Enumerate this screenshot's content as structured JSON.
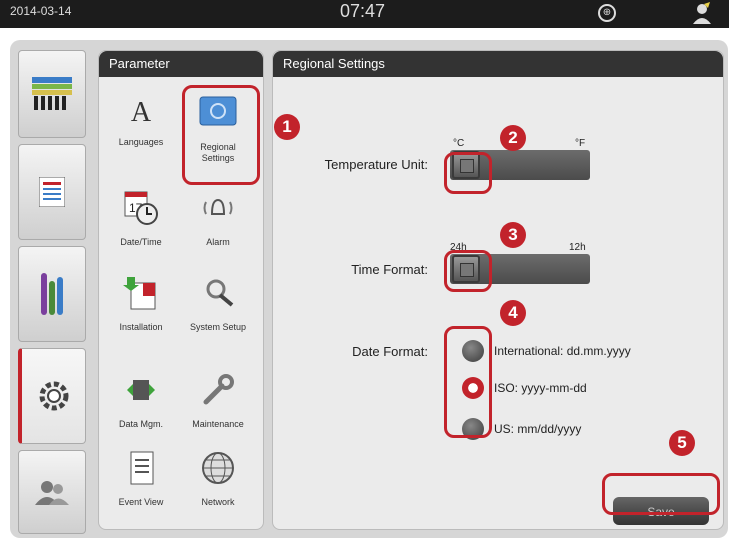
{
  "status_bar": {
    "date": "2014-03-14",
    "time": "07:47"
  },
  "parameter_panel": {
    "title": "Parameter",
    "items": [
      {
        "label": "Languages",
        "icon": "languages-icon"
      },
      {
        "label": "Regional Settings",
        "icon": "regional-settings-icon"
      },
      {
        "label": "Date/Time",
        "icon": "datetime-icon"
      },
      {
        "label": "Alarm",
        "icon": "alarm-icon"
      },
      {
        "label": "Installation",
        "icon": "installation-icon"
      },
      {
        "label": "System Setup",
        "icon": "system-setup-icon"
      },
      {
        "label": "Data Mgm.",
        "icon": "data-management-icon"
      },
      {
        "label": "Maintenance",
        "icon": "maintenance-icon"
      },
      {
        "label": "Event View",
        "icon": "event-view-icon"
      },
      {
        "label": "Network",
        "icon": "network-icon"
      }
    ]
  },
  "regional_panel": {
    "title": "Regional Settings",
    "temperature": {
      "label": "Temperature Unit:",
      "left": "°C",
      "right": "°F",
      "selected": "°C"
    },
    "time_format": {
      "label": "Time Format:",
      "left": "24h",
      "right": "12h",
      "selected": "24h"
    },
    "date_format": {
      "label": "Date Format:",
      "options": [
        "International: dd.mm.yyyy",
        "ISO: yyyy-mm-dd",
        "US: mm/dd/yyyy"
      ],
      "selected": "ISO: yyyy-mm-dd"
    },
    "save_label": "Save"
  },
  "callouts": [
    "1",
    "2",
    "3",
    "4",
    "5"
  ],
  "colors": {
    "accent": "#c2232b",
    "header": "#333333",
    "panel": "#ebebeb"
  }
}
